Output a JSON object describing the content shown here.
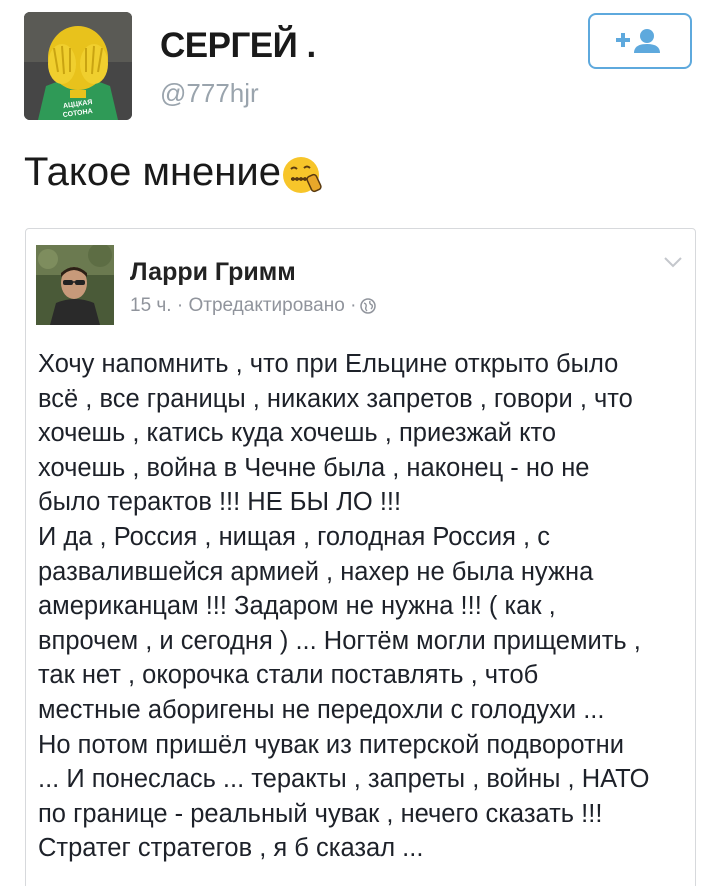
{
  "tweet": {
    "display_name": "СЕРГЕЙ .",
    "handle": "@777hjr",
    "text": "Такое мнение",
    "follow_button_icon": "add-user-icon",
    "avatar_caption_lines": [
      "АЦЦКАЯ",
      "СОТОНА"
    ]
  },
  "embedded_post": {
    "author": "Ларри Гримм",
    "meta": "15 ч. · Отредактировано ·",
    "privacy_icon": "globe-icon",
    "body_lines": [
      "Хочу напомнить , что при Ельцине открыто было",
      "всё , все границы , никаких запретов , говори , что",
      "хочешь , катись куда хочешь , приезжай кто",
      "хочешь , война в Чечне была , наконец - но не",
      "было терактов !!! НЕ БЫ ЛО !!!",
      "И да , Россия , нищая , голодная Россия , с",
      "развалившейся армией , нахер не была нужна",
      "американцам !!! Задаром не нужна !!! ( как ,",
      "впрочем , и сегодня ) ... Ногтём могли прищемить ,",
      "так нет , окорочка стали поставлять , чтоб",
      "местные аборигены не передохли с голодухи ...",
      "Но потом пришёл чувак из питерской подворотни",
      "... И понеслась ... теракты , запреты , войны , НАТО",
      "по границе - реальный чувак , нечего сказать !!!",
      "Стратег стратегов , я б сказал ..."
    ]
  },
  "colors": {
    "accent": "#5ea9dd",
    "text": "#1a1a1a",
    "muted": "#9aa4ad",
    "card_border": "#d7d9dc",
    "emoji": "#f7c52a"
  }
}
